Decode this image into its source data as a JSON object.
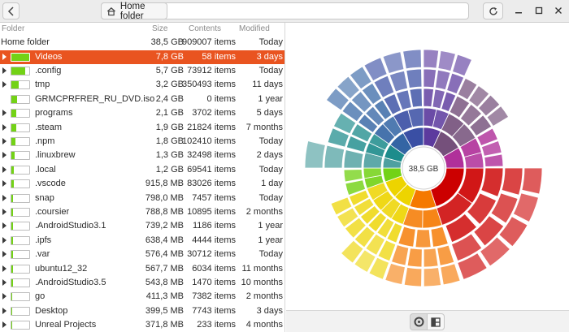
{
  "header": {
    "path_label": "Home folder",
    "back_icon": "chevron-left-icon",
    "home_icon": "home-icon",
    "refresh_icon": "refresh-icon",
    "window_buttons": [
      "minimize-icon",
      "maximize-icon",
      "close-icon"
    ]
  },
  "columns": {
    "folder": "Folder",
    "size": "Size",
    "contents": "Contents",
    "modified": "Modified"
  },
  "root": {
    "name": "Home folder",
    "size": "38,5 GB",
    "contents": "909007 items",
    "modified": "Today"
  },
  "rows": [
    {
      "name": "Videos",
      "size": "7,8 GB",
      "contents": "58 items",
      "modified": "3 days",
      "fraction": 0.2,
      "expandable": true,
      "selected": true
    },
    {
      "name": ".config",
      "size": "5,7 GB",
      "contents": "73912 items",
      "modified": "Today",
      "fraction": 0.15,
      "expandable": true
    },
    {
      "name": "tmp",
      "size": "3,2 GB",
      "contents": "350493 items",
      "modified": "11 days",
      "fraction": 0.08,
      "expandable": true
    },
    {
      "name": "GRMCPRFRER_RU_DVD.iso",
      "size": "2,4 GB",
      "contents": "0 items",
      "modified": "1 year",
      "fraction": 0.06,
      "expandable": false
    },
    {
      "name": "programs",
      "size": "2,1 GB",
      "contents": "3702 items",
      "modified": "5 days",
      "fraction": 0.055,
      "expandable": true
    },
    {
      "name": ".steam",
      "size": "1,9 GB",
      "contents": "21824 items",
      "modified": "7 months",
      "fraction": 0.05,
      "expandable": true
    },
    {
      "name": ".npm",
      "size": "1,8 GB",
      "contents": "102410 items",
      "modified": "Today",
      "fraction": 0.047,
      "expandable": true
    },
    {
      "name": ".linuxbrew",
      "size": "1,3 GB",
      "contents": "32498 items",
      "modified": "2 days",
      "fraction": 0.034,
      "expandable": true
    },
    {
      "name": ".local",
      "size": "1,2 GB",
      "contents": "69541 items",
      "modified": "Today",
      "fraction": 0.031,
      "expandable": true
    },
    {
      "name": ".vscode",
      "size": "915,8 MB",
      "contents": "83026 items",
      "modified": "1 day",
      "fraction": 0.023,
      "expandable": true
    },
    {
      "name": "snap",
      "size": "798,0 MB",
      "contents": "7457 items",
      "modified": "Today",
      "fraction": 0.02,
      "expandable": true
    },
    {
      "name": ".coursier",
      "size": "788,8 MB",
      "contents": "10895 items",
      "modified": "2 months",
      "fraction": 0.02,
      "expandable": true
    },
    {
      "name": ".AndroidStudio3.1",
      "size": "739,2 MB",
      "contents": "1186 items",
      "modified": "1 year",
      "fraction": 0.019,
      "expandable": true
    },
    {
      "name": ".ipfs",
      "size": "638,4 MB",
      "contents": "4444 items",
      "modified": "1 year",
      "fraction": 0.016,
      "expandable": true
    },
    {
      "name": ".var",
      "size": "576,4 MB",
      "contents": "30712 items",
      "modified": "Today",
      "fraction": 0.015,
      "expandable": true
    },
    {
      "name": "ubuntu12_32",
      "size": "567,7 MB",
      "contents": "6034 items",
      "modified": "11 months",
      "fraction": 0.015,
      "expandable": true
    },
    {
      "name": ".AndroidStudio3.5",
      "size": "543,8 MB",
      "contents": "1470 items",
      "modified": "10 months",
      "fraction": 0.014,
      "expandable": true
    },
    {
      "name": "go",
      "size": "411,3 MB",
      "contents": "7382 items",
      "modified": "2 months",
      "fraction": 0.011,
      "expandable": true
    },
    {
      "name": "Desktop",
      "size": "399,5 MB",
      "contents": "7743 items",
      "modified": "3 days",
      "fraction": 0.01,
      "expandable": true
    },
    {
      "name": "Unreal Projects",
      "size": "371,8 MB",
      "contents": "233 items",
      "modified": "4 months",
      "fraction": 0.01,
      "expandable": true
    }
  ],
  "chart": {
    "center_label": "38,5 GB",
    "colors": [
      "#cc0000",
      "#f57900",
      "#edd400",
      "#73d216",
      "#3465a4",
      "#75507b",
      "#c17d11"
    ]
  },
  "toolbar": {
    "ring_icon": "ring-chart-icon",
    "treemap_icon": "treemap-icon"
  },
  "colors": {
    "selection": "#e95420",
    "usage_bar": "#73d216"
  }
}
